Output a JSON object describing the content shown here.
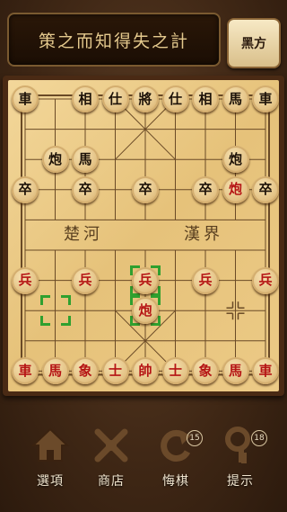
{
  "header": {
    "title": "策之而知得失之計",
    "side_button": "黑方"
  },
  "board": {
    "river_left": "楚河",
    "river_right": "漢界",
    "line_color": "#6a4a26",
    "pieces": [
      {
        "col": 0,
        "row": 0,
        "char": "車",
        "side": "black"
      },
      {
        "col": 2,
        "row": 0,
        "char": "相",
        "side": "black"
      },
      {
        "col": 3,
        "row": 0,
        "char": "仕",
        "side": "black"
      },
      {
        "col": 4,
        "row": 0,
        "char": "將",
        "side": "black"
      },
      {
        "col": 5,
        "row": 0,
        "char": "仕",
        "side": "black"
      },
      {
        "col": 6,
        "row": 0,
        "char": "相",
        "side": "black"
      },
      {
        "col": 7,
        "row": 0,
        "char": "馬",
        "side": "black"
      },
      {
        "col": 8,
        "row": 0,
        "char": "車",
        "side": "black"
      },
      {
        "col": 1,
        "row": 2,
        "char": "炮",
        "side": "black"
      },
      {
        "col": 2,
        "row": 2,
        "char": "馬",
        "side": "black"
      },
      {
        "col": 7,
        "row": 2,
        "char": "炮",
        "side": "black"
      },
      {
        "col": 0,
        "row": 3,
        "char": "卒",
        "side": "black"
      },
      {
        "col": 2,
        "row": 3,
        "char": "卒",
        "side": "black"
      },
      {
        "col": 4,
        "row": 3,
        "char": "卒",
        "side": "black"
      },
      {
        "col": 6,
        "row": 3,
        "char": "卒",
        "side": "black"
      },
      {
        "col": 7,
        "row": 3,
        "char": "炮",
        "side": "red"
      },
      {
        "col": 8,
        "row": 3,
        "char": "卒",
        "side": "black"
      },
      {
        "col": 0,
        "row": 6,
        "char": "兵",
        "side": "red"
      },
      {
        "col": 2,
        "row": 6,
        "char": "兵",
        "side": "red"
      },
      {
        "col": 4,
        "row": 6,
        "char": "兵",
        "side": "red"
      },
      {
        "col": 6,
        "row": 6,
        "char": "兵",
        "side": "red"
      },
      {
        "col": 8,
        "row": 6,
        "char": "兵",
        "side": "red"
      },
      {
        "col": 4,
        "row": 7,
        "char": "炮",
        "side": "red"
      },
      {
        "col": 0,
        "row": 9,
        "char": "車",
        "side": "red"
      },
      {
        "col": 1,
        "row": 9,
        "char": "馬",
        "side": "red"
      },
      {
        "col": 2,
        "row": 9,
        "char": "象",
        "side": "red"
      },
      {
        "col": 3,
        "row": 9,
        "char": "士",
        "side": "red"
      },
      {
        "col": 4,
        "row": 9,
        "char": "帥",
        "side": "red"
      },
      {
        "col": 5,
        "row": 9,
        "char": "士",
        "side": "red"
      },
      {
        "col": 6,
        "row": 9,
        "char": "象",
        "side": "red"
      },
      {
        "col": 7,
        "row": 9,
        "char": "馬",
        "side": "red"
      },
      {
        "col": 8,
        "row": 9,
        "char": "車",
        "side": "red"
      }
    ],
    "selection_markers": [
      {
        "col": 1,
        "row": 7
      },
      {
        "col": 4,
        "row": 6
      },
      {
        "col": 4,
        "row": 7
      }
    ],
    "position_markers": [
      {
        "col": 7,
        "row": 7
      }
    ]
  },
  "toolbar": {
    "options": "選項",
    "shop": "商店",
    "undo": "悔棋",
    "undo_count": "15",
    "hint": "提示",
    "hint_count": "18"
  }
}
